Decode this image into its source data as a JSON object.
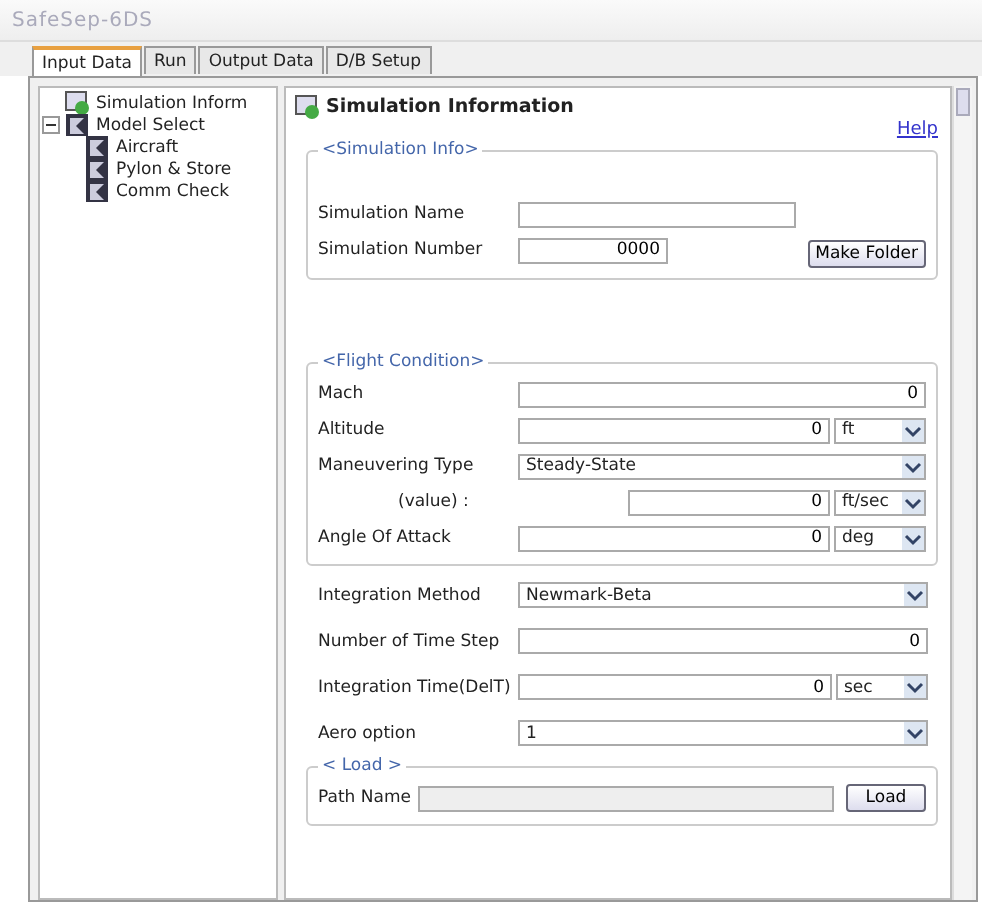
{
  "window": {
    "title": "SafeSep-6DS"
  },
  "tabs": [
    {
      "label": "Input Data",
      "selected": true
    },
    {
      "label": "Run",
      "selected": false
    },
    {
      "label": "Output Data",
      "selected": false
    },
    {
      "label": "D/B Setup",
      "selected": false
    }
  ],
  "tree": [
    {
      "label": "Simulation Inform"
    },
    {
      "label": "Model Select",
      "expanded": true,
      "children": [
        {
          "label": "Aircraft"
        },
        {
          "label": "Pylon & Store"
        },
        {
          "label": "Comm Check"
        }
      ]
    }
  ],
  "header": {
    "title": "Simulation Information",
    "help": "Help"
  },
  "simulation_info": {
    "legend": "<Simulation Info>",
    "rows": [
      {
        "kind": "text",
        "label": "Simulation Name"
      },
      {
        "kind": "text",
        "label": "Simulation Number",
        "value": "0000"
      }
    ],
    "button": "Make Folder"
  },
  "flight_condition": {
    "legend": "<Flight Condition>",
    "rows": [
      {
        "kind": "text",
        "label": "Mach",
        "value": "0"
      },
      {
        "kind": "unit",
        "label": "Altitude",
        "value": "0",
        "unit": "ft"
      },
      {
        "kind": "select",
        "label": "Maneuvering Type",
        "value": "Steady-State"
      },
      {
        "kind": "sub-unit",
        "label": "(value) :",
        "value": "0",
        "unit": "ft/sec"
      },
      {
        "kind": "unit",
        "label": "Angle Of Attack",
        "value": "0",
        "unit": "deg"
      }
    ]
  },
  "integration": [
    {
      "kind": "select",
      "label": "Integration Method",
      "value": "Newmark-Beta"
    },
    {
      "kind": "text",
      "label": "Number of Time Step",
      "value": "0"
    },
    {
      "kind": "unit",
      "label": "Integration Time(DelT)",
      "value": "0",
      "unit": "sec"
    },
    {
      "kind": "select",
      "label": "Aero option",
      "value": "1"
    }
  ],
  "load": {
    "legend": "< Load >",
    "label": "Path Name",
    "button": "Load"
  }
}
